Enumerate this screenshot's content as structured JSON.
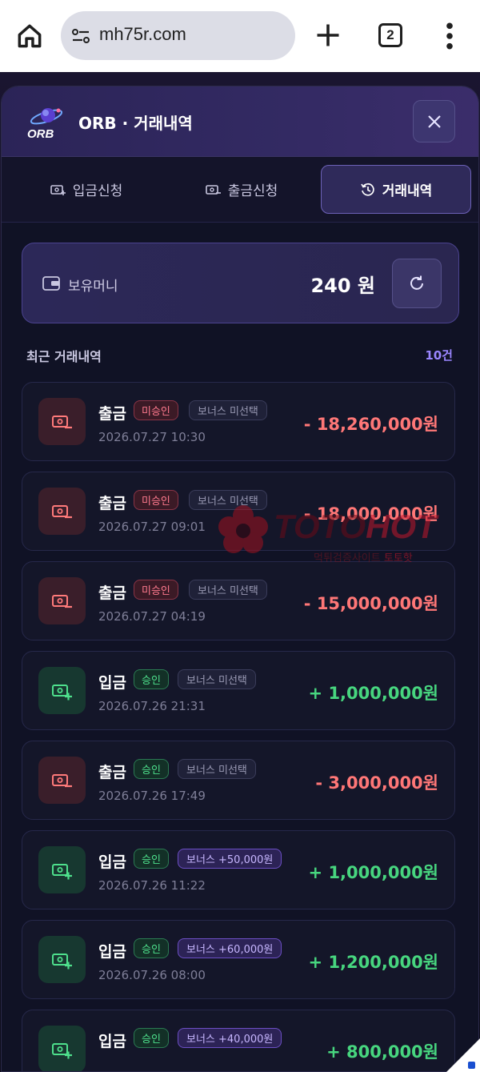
{
  "browser": {
    "url": "mh75r.com",
    "tab_count": "2"
  },
  "modal": {
    "title": "ORB · 거래내역",
    "logo_text": "ORB"
  },
  "tabs": [
    {
      "label": "입금신청",
      "icon": "deposit-icon",
      "active": false
    },
    {
      "label": "출금신청",
      "icon": "withdraw-icon",
      "active": false
    },
    {
      "label": "거래내역",
      "icon": "history-icon",
      "active": true
    }
  ],
  "balance": {
    "label": "보유머니",
    "value": "240 원"
  },
  "section": {
    "title": "최근 거래내역",
    "count": "10건"
  },
  "transactions": [
    {
      "type": "출금",
      "direction": "out",
      "status": "미승인",
      "status_kind": "pending",
      "bonus": "보너스 미선택",
      "bonus_kind": "none",
      "date": "2026.07.27 10:30",
      "amount": "- 18,260,000원"
    },
    {
      "type": "출금",
      "direction": "out",
      "status": "미승인",
      "status_kind": "pending",
      "bonus": "보너스 미선택",
      "bonus_kind": "none",
      "date": "2026.07.27 09:01",
      "amount": "- 18,000,000원"
    },
    {
      "type": "출금",
      "direction": "out",
      "status": "미승인",
      "status_kind": "pending",
      "bonus": "보너스 미선택",
      "bonus_kind": "none",
      "date": "2026.07.27 04:19",
      "amount": "- 15,000,000원"
    },
    {
      "type": "입금",
      "direction": "in",
      "status": "승인",
      "status_kind": "approved",
      "bonus": "보너스 미선택",
      "bonus_kind": "none",
      "date": "2026.07.26 21:31",
      "amount": "+ 1,000,000원"
    },
    {
      "type": "출금",
      "direction": "out",
      "status": "승인",
      "status_kind": "approved",
      "bonus": "보너스 미선택",
      "bonus_kind": "none",
      "date": "2026.07.26 17:49",
      "amount": "- 3,000,000원"
    },
    {
      "type": "입금",
      "direction": "in",
      "status": "승인",
      "status_kind": "approved",
      "bonus": "보너스 +50,000원",
      "bonus_kind": "amount",
      "date": "2026.07.26 11:22",
      "amount": "+ 1,000,000원"
    },
    {
      "type": "입금",
      "direction": "in",
      "status": "승인",
      "status_kind": "approved",
      "bonus": "보너스 +60,000원",
      "bonus_kind": "amount",
      "date": "2026.07.26 08:00",
      "amount": "+ 1,200,000원"
    },
    {
      "type": "입금",
      "direction": "in",
      "status": "승인",
      "status_kind": "approved",
      "bonus": "보너스 +40,000원",
      "bonus_kind": "amount",
      "date": "",
      "amount": "+ 800,000원"
    }
  ],
  "watermark": {
    "brand_a": "TOTO",
    "brand_b": "HOT",
    "sub_a": "먹튀검증사이트",
    "sub_b": "토토핫"
  }
}
